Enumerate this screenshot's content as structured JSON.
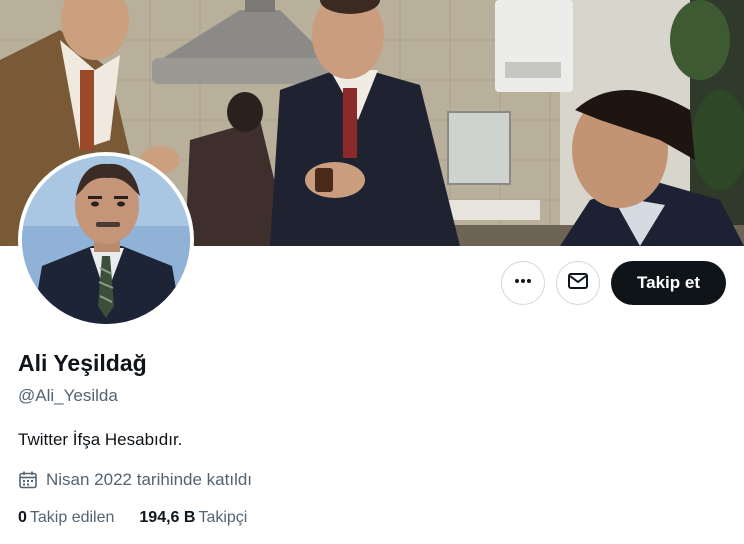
{
  "profile": {
    "display_name": "Ali Yeşildağ",
    "handle": "@Ali_Yesilda",
    "bio": "Twitter İfşa Hesabıdır.",
    "joined": "Nisan 2022 tarihinde katıldı",
    "joined_icon": "calendar-icon"
  },
  "stats": {
    "following_count": "0",
    "following_label": "Takip edilen",
    "followers_count": "194,6 B",
    "followers_label": "Takipçi"
  },
  "actions": {
    "more_icon": "more-icon",
    "message_icon": "mail-icon",
    "follow_label": "Takip et"
  },
  "colors": {
    "text_primary": "#0f1419",
    "text_secondary": "#536471",
    "follow_button_bg": "#0f1419",
    "border": "#cfd9de"
  }
}
